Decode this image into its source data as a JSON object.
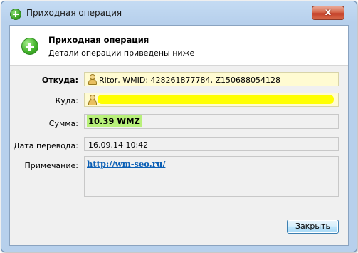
{
  "window": {
    "title": "Приходная операция",
    "close_glyph": "x"
  },
  "header": {
    "title": "Приходная операция",
    "subtitle": "Детали операции приведены ниже",
    "icon": "plus-circle-icon"
  },
  "form": {
    "from_label": "Откуда:",
    "from_value": "Ritor, WMID: 428261877784, Z150688054128",
    "to_label": "Куда:",
    "to_value": "",
    "amount_label": "Сумма:",
    "amount_value": "10.39 WMZ",
    "date_label": "Дата перевода:",
    "date_value": "16.09.14 10:42",
    "note_label": "Примечание:",
    "note_value": "http://wm-seo.ru/"
  },
  "buttons": {
    "close_label": "Закрыть"
  },
  "colors": {
    "highlight_field": "#fffbd2",
    "amount_highlight": "#b8f07a",
    "redaction": "#ffff00",
    "link": "#0b5fb5"
  }
}
